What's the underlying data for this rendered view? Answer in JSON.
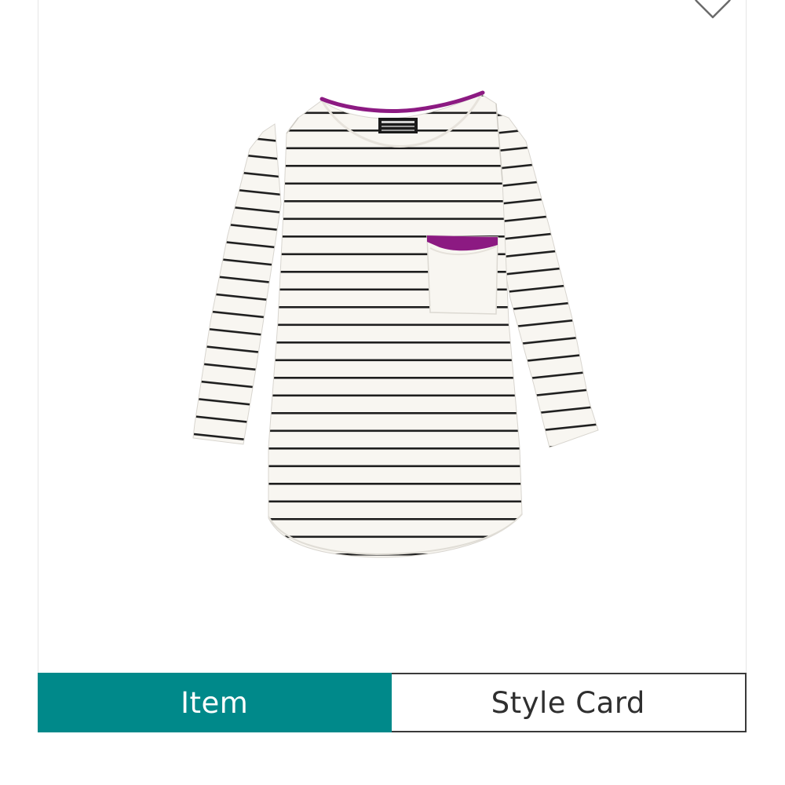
{
  "colors": {
    "accent": "#00898a",
    "trim": "#8c1a82",
    "stripe": "#1e1e1e",
    "fabric": "#f8f6f1"
  },
  "favorite": {
    "icon": "heart-outline-icon"
  },
  "product": {
    "image": "striped-three-quarter-sleeve-pocket-top"
  },
  "tabs": [
    {
      "label": "Item",
      "active": true
    },
    {
      "label": "Style Card",
      "active": false
    }
  ]
}
